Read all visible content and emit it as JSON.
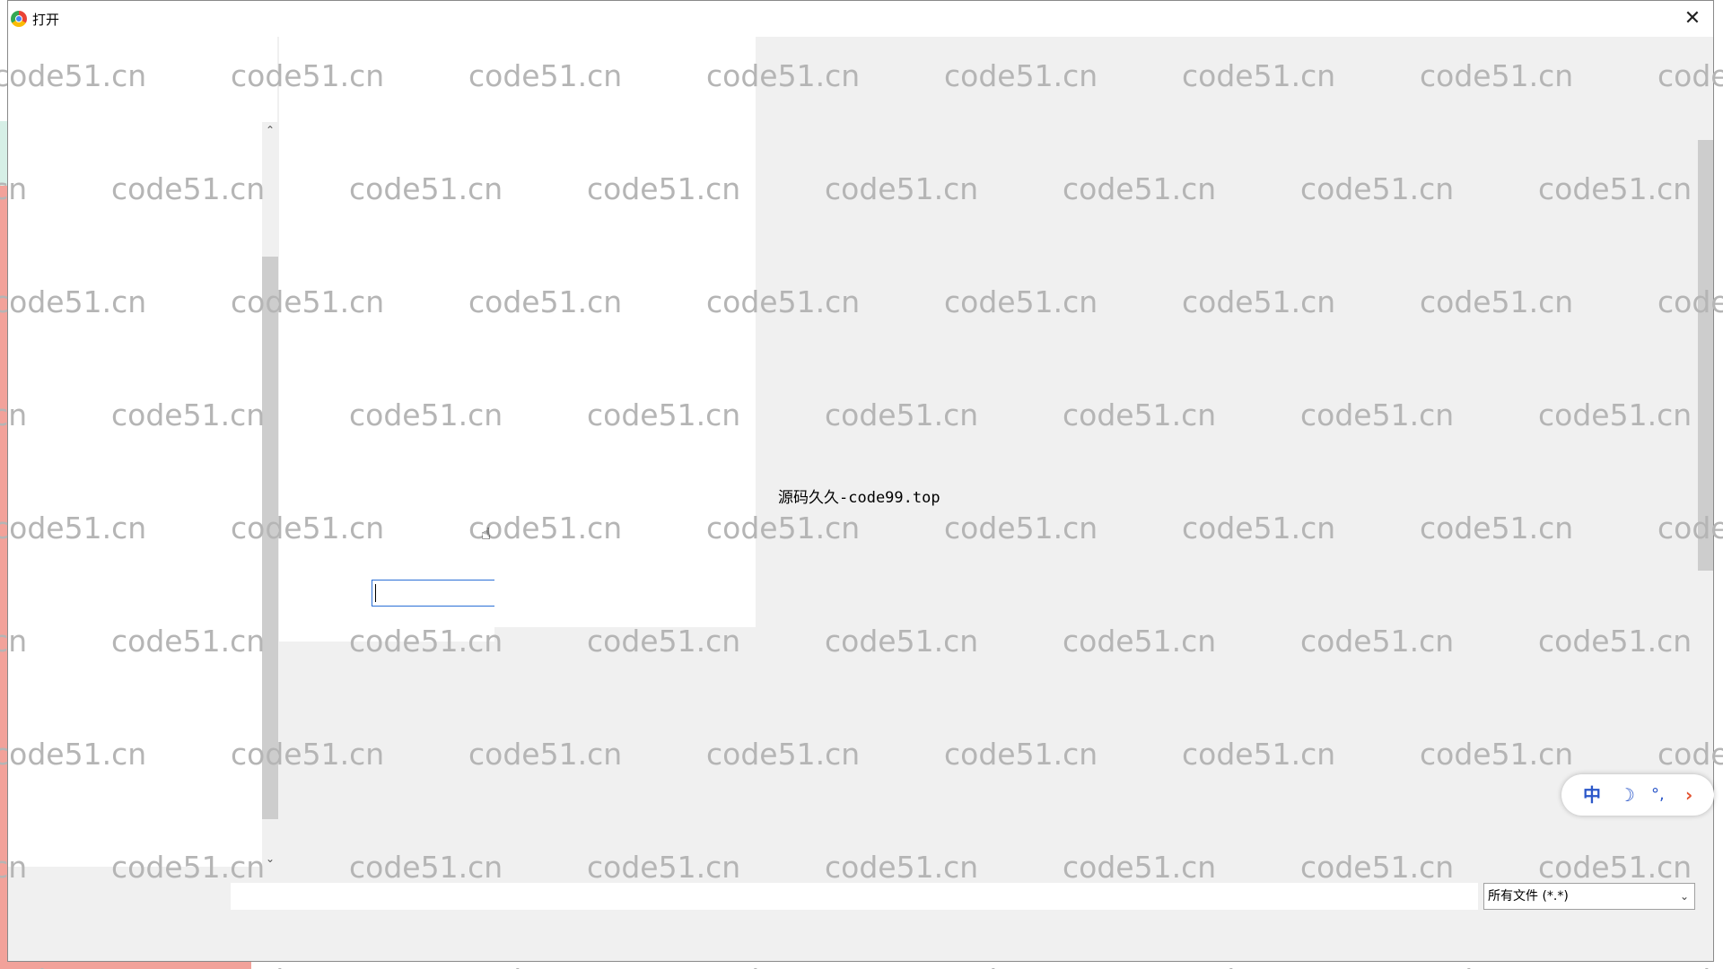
{
  "window": {
    "title": "打开",
    "close_glyph": "✕",
    "app_icon": "chrome-icon"
  },
  "nav_pane": {
    "scroll_up_glyph": "⌃",
    "scroll_down_glyph": "⌄"
  },
  "main": {
    "center_text": "源码久久-code99.top",
    "rename_value": ""
  },
  "watermark": {
    "text": "code51.cn"
  },
  "ime_toolbar": {
    "mode": "中",
    "moon_glyph": "☽",
    "punct_glyph": "°,",
    "arrow_glyph": "›"
  },
  "bottom": {
    "filename_value": "",
    "filetype_selected": "所有文件 (*.*)",
    "dropdown_glyph": "⌄"
  },
  "colors": {
    "accent": "#2a6fd6",
    "ime_blue": "#2b57c9",
    "ime_orange": "#e2522f"
  }
}
